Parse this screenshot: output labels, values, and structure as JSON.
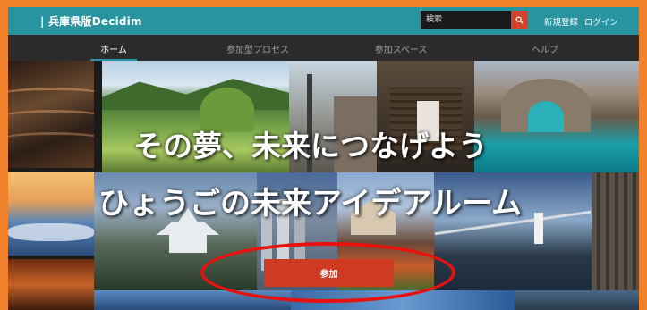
{
  "header": {
    "brand": "| 兵庫県版Decidim",
    "search": {
      "placeholder": "検索",
      "icon": "search-icon"
    },
    "register_label": "新規登録",
    "login_label": "ログイン",
    "accent_color": "#2794a0"
  },
  "menu": {
    "items": [
      {
        "label": "ホーム",
        "active": true
      },
      {
        "label": "参加型プロセス",
        "active": false
      },
      {
        "label": "参加スペース",
        "active": false
      },
      {
        "label": "ヘルプ",
        "active": false
      }
    ]
  },
  "hero": {
    "line1": "その夢、未来につなげよう",
    "line2": "ひょうごの未来アイデアルーム",
    "join_label": "参加",
    "join_color": "#cf3a22",
    "highlight_color": "#e8110c"
  }
}
